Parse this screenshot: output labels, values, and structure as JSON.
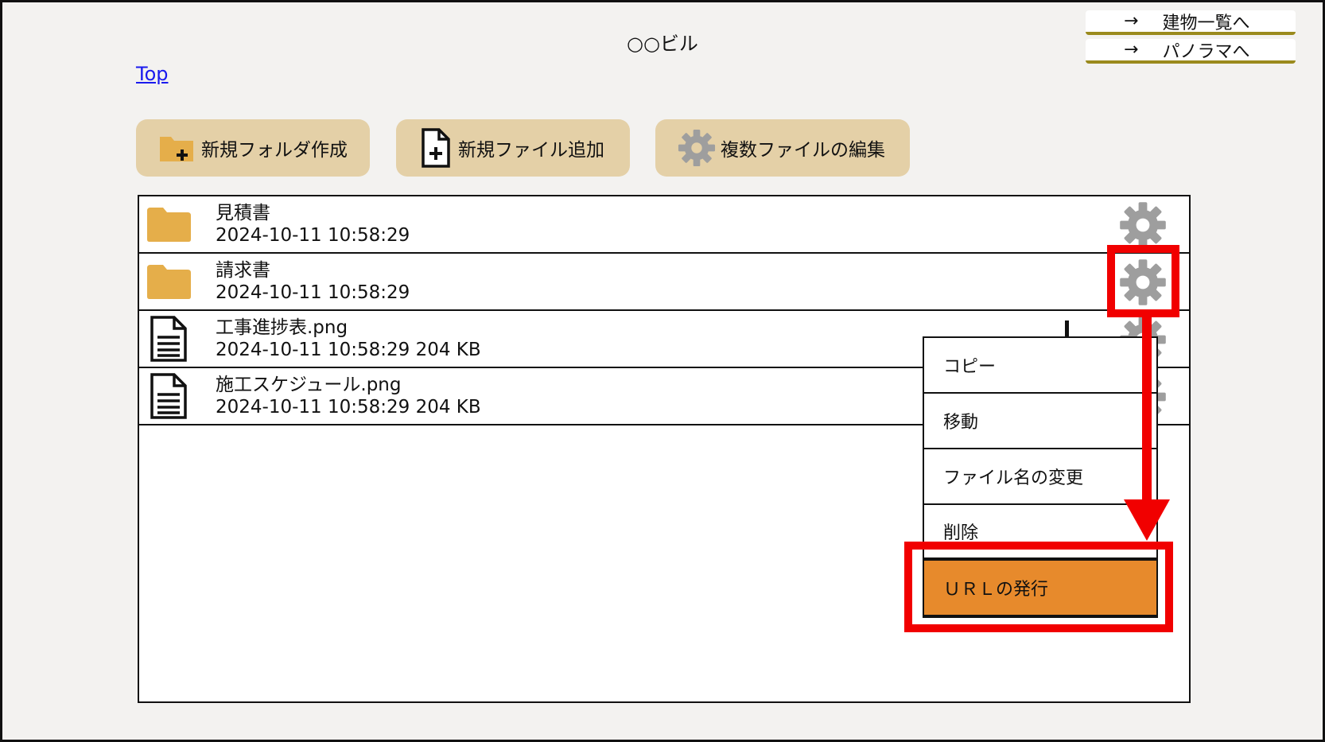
{
  "header": {
    "title": "○○ビル",
    "top_link": "Top",
    "nav": [
      {
        "arrow": "→",
        "label": "建物一覧へ"
      },
      {
        "arrow": "→",
        "label": "パノラマへ"
      }
    ]
  },
  "toolbar": {
    "new_folder": "新規フォルダ作成",
    "new_file": "新規ファイル追加",
    "edit_multiple": "複数ファイルの編集"
  },
  "files": [
    {
      "type": "folder",
      "name": "見積書",
      "meta": "2024-10-11 10:58:29"
    },
    {
      "type": "folder",
      "name": "請求書",
      "meta": "2024-10-11 10:58:29"
    },
    {
      "type": "file",
      "name": "工事進捗表.png",
      "meta": "2024-10-11 10:58:29 204 KB"
    },
    {
      "type": "file",
      "name": "施工スケジュール.png",
      "meta": "2024-10-11 10:58:29 204 KB"
    }
  ],
  "context_menu": {
    "items": [
      "コピー",
      "移動",
      "ファイル名の変更",
      "削除",
      "ＵＲＬの発行"
    ]
  },
  "colors": {
    "background": "#f3f2f0",
    "button": "#e4d0a7",
    "folder": "#e5ae4a",
    "gear": "#9e9e9e",
    "active_item": "#e78a2c",
    "highlight": "#f10000",
    "nav_underline": "#9a8a1d"
  },
  "icons": {
    "folder": "folder-icon",
    "file": "document-icon",
    "settings": "gear-icon",
    "folder_add": "folder-plus-icon",
    "file_add": "file-plus-icon"
  }
}
